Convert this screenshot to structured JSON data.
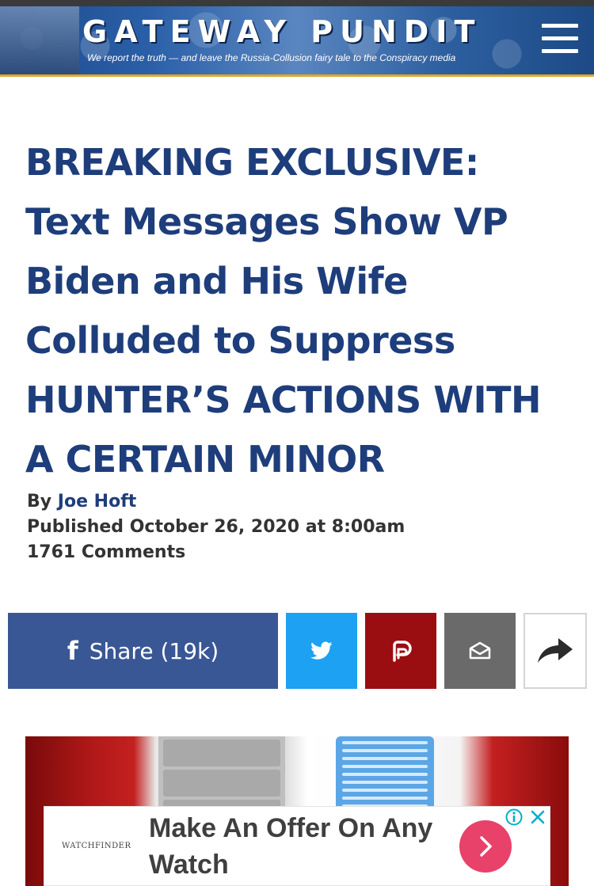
{
  "header": {
    "logo": "GATEWAY PUNDIT",
    "tagline": "We report the truth — and leave the Russia-Collusion fairy tale to the Conspiracy media",
    "menu_icon": "hamburger-menu-icon"
  },
  "article": {
    "headline": "BREAKING EXCLUSIVE: Text Messages Show VP Biden and His Wife Colluded to Suppress HUNTER’S ACTIONS WITH A CERTAIN MINOR",
    "byline_prefix": "By",
    "author": "Joe Hoft",
    "published": "Published October 26, 2020 at 8:00am",
    "comments": "1761 Comments"
  },
  "share": {
    "facebook_label": "Share (19k)",
    "facebook_icon": "f",
    "twitter_icon": "twitter-bird-icon",
    "parler_icon": "parler-icon",
    "email_icon": "envelope-icon",
    "more_icon": "share-arrow-icon"
  },
  "ad": {
    "brand": "WATCHFINDER",
    "headline": "Make An Offer On Any Watch",
    "info_icon": "info-icon",
    "close_icon": "close-icon",
    "cta_icon": "chevron-right-icon"
  },
  "colors": {
    "headline": "#1e3d7b",
    "facebook": "#3a5795",
    "twitter": "#1da1f2",
    "parler": "#9a0d11",
    "email": "#6a6a6a",
    "ad_cta": "#e8416a"
  }
}
